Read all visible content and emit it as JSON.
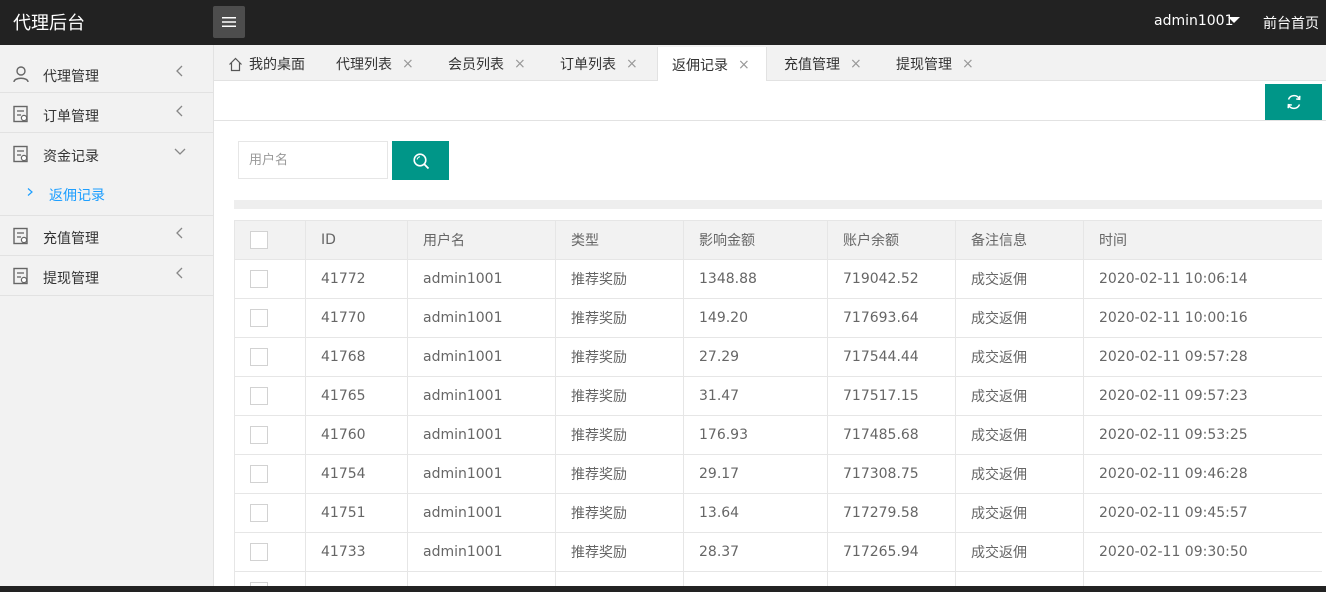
{
  "header": {
    "brand": "代理后台",
    "user": "admin1001",
    "front_link": "前台首页"
  },
  "sidebar": {
    "items": [
      {
        "label": "代理管理",
        "icon": "user-icon"
      },
      {
        "label": "订单管理",
        "icon": "document-icon"
      },
      {
        "label": "资金记录",
        "icon": "document-icon",
        "expanded": true
      },
      {
        "label": "充值管理",
        "icon": "document-icon"
      },
      {
        "label": "提现管理",
        "icon": "document-icon"
      }
    ],
    "sub_item": {
      "label": "返佣记录"
    }
  },
  "tabs": [
    {
      "label": "我的桌面",
      "closable": false
    },
    {
      "label": "代理列表",
      "closable": true
    },
    {
      "label": "会员列表",
      "closable": true
    },
    {
      "label": "订单列表",
      "closable": true
    },
    {
      "label": "返佣记录",
      "closable": true,
      "active": true
    },
    {
      "label": "充值管理",
      "closable": true
    },
    {
      "label": "提现管理",
      "closable": true
    }
  ],
  "tab_close_glyph": "×",
  "search": {
    "placeholder": "用户名"
  },
  "colors": {
    "accent": "#009688",
    "active_link": "#1e9fff",
    "header_bg": "#222222"
  },
  "table": {
    "columns": [
      "ID",
      "用户名",
      "类型",
      "影响金额",
      "账户余额",
      "备注信息",
      "时间"
    ],
    "rows": [
      [
        "41772",
        "admin1001",
        "推荐奖励",
        "1348.88",
        "719042.52",
        "成交返佣",
        "2020-02-11 10:06:14"
      ],
      [
        "41770",
        "admin1001",
        "推荐奖励",
        "149.20",
        "717693.64",
        "成交返佣",
        "2020-02-11 10:00:16"
      ],
      [
        "41768",
        "admin1001",
        "推荐奖励",
        "27.29",
        "717544.44",
        "成交返佣",
        "2020-02-11 09:57:28"
      ],
      [
        "41765",
        "admin1001",
        "推荐奖励",
        "31.47",
        "717517.15",
        "成交返佣",
        "2020-02-11 09:57:23"
      ],
      [
        "41760",
        "admin1001",
        "推荐奖励",
        "176.93",
        "717485.68",
        "成交返佣",
        "2020-02-11 09:53:25"
      ],
      [
        "41754",
        "admin1001",
        "推荐奖励",
        "29.17",
        "717308.75",
        "成交返佣",
        "2020-02-11 09:46:28"
      ],
      [
        "41751",
        "admin1001",
        "推荐奖励",
        "13.64",
        "717279.58",
        "成交返佣",
        "2020-02-11 09:45:57"
      ],
      [
        "41733",
        "admin1001",
        "推荐奖励",
        "28.37",
        "717265.94",
        "成交返佣",
        "2020-02-11 09:30:50"
      ]
    ]
  }
}
